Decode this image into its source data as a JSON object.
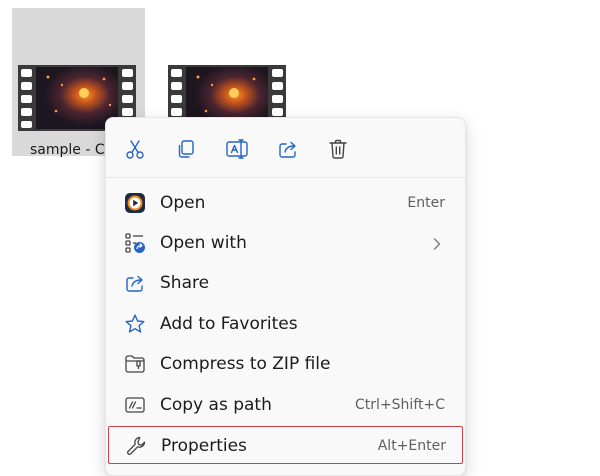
{
  "files": [
    {
      "name": "sample - Co",
      "selected": true
    },
    {
      "name": "",
      "selected": false
    }
  ],
  "toolbar": {
    "cut_icon": "scissors-icon",
    "copy_icon": "copy-icon",
    "rename_icon": "rename-icon",
    "share_icon": "share-icon",
    "delete_icon": "trash-icon"
  },
  "menu": {
    "items": [
      {
        "label": "Open",
        "shortcut": "Enter",
        "icon": "media-player-icon"
      },
      {
        "label": "Open with",
        "shortcut": "",
        "icon": "open-with-icon",
        "submenu": true
      },
      {
        "label": "Share",
        "shortcut": "",
        "icon": "share-icon"
      },
      {
        "label": "Add to Favorites",
        "shortcut": "",
        "icon": "star-icon"
      },
      {
        "label": "Compress to ZIP file",
        "shortcut": "",
        "icon": "zip-folder-icon"
      },
      {
        "label": "Copy as path",
        "shortcut": "Ctrl+Shift+C",
        "icon": "copy-path-icon"
      },
      {
        "label": "Properties",
        "shortcut": "Alt+Enter",
        "icon": "wrench-icon",
        "highlighted": true
      }
    ]
  },
  "colors": {
    "selection_bg": "#d9d9d9",
    "menu_bg": "#f9f9f9",
    "icon_blue": "#2563c7",
    "highlight_border": "#d0404a"
  }
}
